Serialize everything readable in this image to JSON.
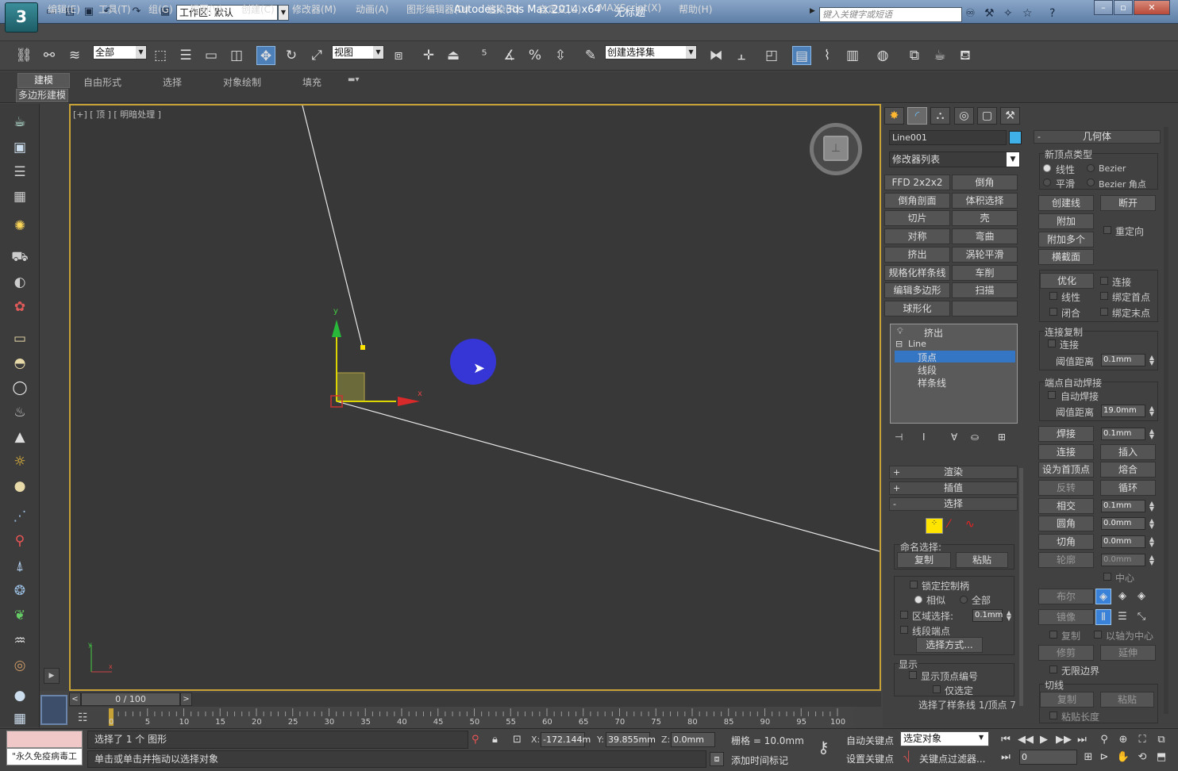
{
  "titlebar": {
    "logo": "3",
    "workspace": "工作区: 默认",
    "app_title": "Autodesk 3ds Max  2014 x64",
    "doc_title": "无标题",
    "search_placeholder": "键入关键字或短语"
  },
  "menu": [
    "编辑(E)",
    "工具(T)",
    "组(G)",
    "视图(V)",
    "创建(C)",
    "修改器(M)",
    "动画(A)",
    "图形编辑器(D)",
    "渲染(R)",
    "自定义(U)",
    "MAXScript(X)",
    "帮助(H)"
  ],
  "toolbar": {
    "filter": "全部",
    "ref_coord": "视图",
    "selection_set": "创建选择集"
  },
  "ribbon": {
    "tabs": [
      "建模",
      "自由形式",
      "选择",
      "对象绘制",
      "填充"
    ],
    "subtab": "多边形建模"
  },
  "viewport": {
    "label": "[+] [ 顶 ] [ 明暗处理 ]",
    "axis_x": "x",
    "axis_y": "y",
    "axis_x_small": "x",
    "axis_y_small": "y"
  },
  "timeline": {
    "slider": "0 / 100",
    "ticks": [
      "0",
      "5",
      "10",
      "15",
      "20",
      "25",
      "30",
      "35",
      "40",
      "45",
      "50",
      "55",
      "60",
      "65",
      "70",
      "75",
      "80",
      "85",
      "90",
      "95",
      "100"
    ]
  },
  "status": {
    "listener_label": "\"永久免疫病毒工",
    "line1": "选择了 1 个 图形",
    "line2": "单击或单击并拖动以选择对象",
    "x_label": "X:",
    "x_value": "-172.144m",
    "y_label": "Y:",
    "y_value": "39.855mm",
    "z_label": "Z:",
    "z_value": "0.0mm",
    "grid": "栅格 = 10.0mm",
    "add_time_tag": "添加时间标记",
    "auto_key": "自动关键点",
    "set_key": "设置关键点",
    "key_select": "选定对象",
    "key_filters": "关键点过滤器...",
    "frame": "0"
  },
  "cmdpanel": {
    "object_name": "Line001",
    "object_color": "#40b0e8",
    "modifier_list": "修改器列表",
    "modifier_buttons": [
      "FFD 2x2x2",
      "倒角",
      "倒角剖面",
      "体积选择",
      "切片",
      "壳",
      "对称",
      "弯曲",
      "挤出",
      "涡轮平滑",
      "规格化样条线",
      "车削",
      "编辑多边形",
      "扫描",
      "球形化",
      ""
    ],
    "stack": {
      "top": "挤出",
      "base": "Line",
      "sub": [
        "顶点",
        "线段",
        "样条线"
      ]
    },
    "rollouts": {
      "render": "渲染",
      "interp": "插值",
      "select": "选择"
    },
    "select": {
      "named_sel": "命名选择:",
      "copy": "复制",
      "paste": "粘贴",
      "lock_handles": "锁定控制柄",
      "alike": "相似",
      "all": "全部",
      "area_sel": "区域选择:",
      "area_val": "0.1mm",
      "seg_end": "线段端点",
      "sel_by": "选择方式...",
      "display": "显示",
      "show_vert_num": "显示顶点编号",
      "sel_only": "仅选定",
      "sel_status": "选择了样条线 1/顶点 7"
    },
    "geometry": {
      "title": "几何体",
      "new_vert_type": "新顶点类型",
      "linear": "线性",
      "bezier": "Bezier",
      "smooth": "平滑",
      "bezier_corner": "Bezier 角点",
      "create_line": "创建线",
      "break": "断开",
      "attach": "附加",
      "reorient": "重定向",
      "attach_mult": "附加多个",
      "cross_section": "横截面",
      "refine": "优化",
      "connect": "连接",
      "linear2": "线性",
      "bind_first": "绑定首点",
      "closed": "闭合",
      "bind_last": "绑定末点",
      "connect_copy": "连接复制",
      "connect2": "连接",
      "threshold": "阈值距离",
      "threshold_val": "0.1mm",
      "end_auto_weld": "端点自动焊接",
      "auto_weld": "自动焊接",
      "threshold2": "阈值距离",
      "threshold2_val": "19.0mm",
      "weld": "焊接",
      "weld_val": "0.1mm",
      "connect3": "连接",
      "insert": "插入",
      "make_first": "设为首顶点",
      "fuse": "熔合",
      "reverse": "反转",
      "cycle": "循环",
      "cross_insert": "相交",
      "cross_val": "0.1mm",
      "fillet": "圆角",
      "fillet_val": "0.0mm",
      "chamfer": "切角",
      "chamfer_val": "0.0mm",
      "outline": "轮廓",
      "outline_val": "0.0mm",
      "center": "中心",
      "boolean": "布尔",
      "mirror": "镜像",
      "copy": "复制",
      "about_pivot": "以轴为中心",
      "trim": "修剪",
      "extend": "延伸",
      "infinite_bounds": "无限边界",
      "tangent": "切线",
      "tan_copy": "复制",
      "tan_paste": "粘贴",
      "paste_length": "粘贴长度"
    }
  }
}
